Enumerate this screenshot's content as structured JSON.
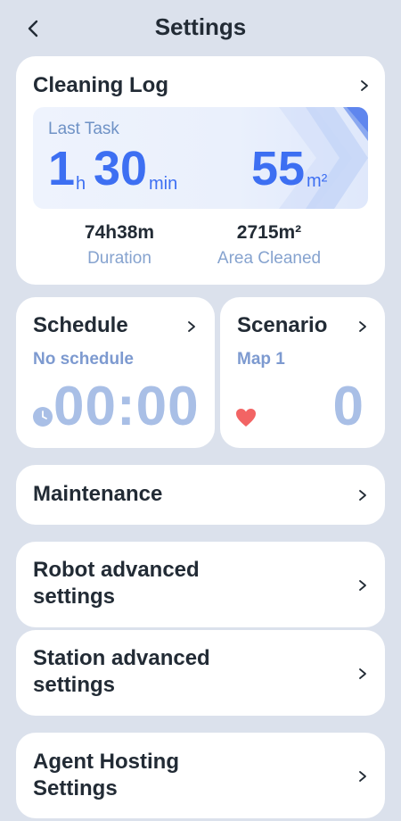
{
  "header": {
    "title": "Settings"
  },
  "cleaning_log": {
    "title": "Cleaning Log",
    "last_task": {
      "label": "Last Task",
      "hours": "1",
      "hours_unit": "h",
      "minutes": "30",
      "minutes_unit": "min",
      "area": "55",
      "area_unit": "m²"
    },
    "totals": {
      "duration_value": "74h38m",
      "duration_label": "Duration",
      "area_value": "2715m²",
      "area_label": "Area Cleaned"
    }
  },
  "schedule": {
    "title": "Schedule",
    "subtitle": "No schedule",
    "time": "00:00"
  },
  "scenario": {
    "title": "Scenario",
    "subtitle": "Map 1",
    "count": "0"
  },
  "menu": {
    "maintenance": "Maintenance",
    "robot_line1": "Robot advanced",
    "robot_line2": "settings",
    "station_line1": "Station advanced",
    "station_line2": "settings",
    "agent_line1": "Agent Hosting",
    "agent_line2": "Settings"
  },
  "colors": {
    "background": "#dbe1ec",
    "card": "#ffffff",
    "accent_blue": "#3d6ff2",
    "muted_blue": "#a9bfe6",
    "heart": "#f26464"
  },
  "icons": [
    "back-arrow-icon",
    "chevron-right-icon",
    "clock-icon",
    "heart-icon"
  ]
}
